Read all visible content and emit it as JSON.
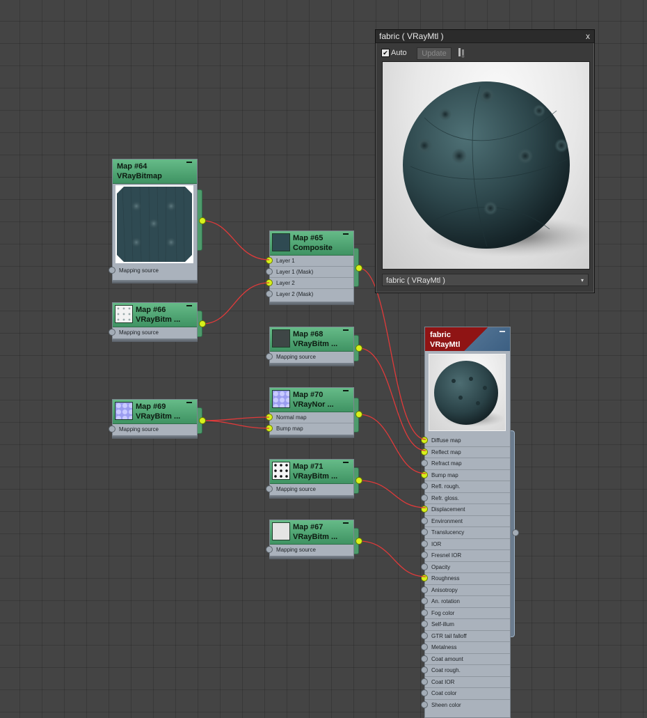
{
  "preview_window": {
    "title": "fabric  ( VRayMtl )",
    "close": "x",
    "auto_label": "Auto",
    "auto_checked": true,
    "update_label": "Update",
    "material_dropdown": "fabric  ( VRayMtl )",
    "dropdown_arrow": "▾"
  },
  "nodes": {
    "map64": {
      "name": "Map #64",
      "type": "VRayBitmap",
      "slots": [
        "Mapping source"
      ]
    },
    "map65": {
      "name": "Map #65",
      "type": "Composite",
      "slots": [
        "Layer 1",
        "Layer 1 (Mask)",
        "Layer 2",
        "Layer 2 (Mask)"
      ]
    },
    "map66": {
      "name": "Map #66",
      "type": "VRayBitm ...",
      "slots": [
        "Mapping source"
      ]
    },
    "map68": {
      "name": "Map #68",
      "type": "VRayBitm ...",
      "slots": [
        "Mapping source"
      ]
    },
    "map69": {
      "name": "Map #69",
      "type": "VRayBitm ...",
      "slots": [
        "Mapping source"
      ]
    },
    "map70": {
      "name": "Map #70",
      "type": "VRayNor ...",
      "slots": [
        "Normal map",
        "Bump map"
      ]
    },
    "map71": {
      "name": "Map #71",
      "type": "VRayBitm ...",
      "slots": [
        "Mapping source"
      ]
    },
    "map67": {
      "name": "Map #67",
      "type": "VRayBitm ...",
      "slots": [
        "Mapping source"
      ]
    }
  },
  "material": {
    "name": "fabric",
    "type": "VRayMtl",
    "slots": [
      "Diffuse map",
      "Reflect map",
      "Refract map",
      "Bump map",
      "Refl. rough.",
      "Refr. gloss.",
      "Displacement",
      "Environment",
      "Translucency",
      "IOR",
      "Fresnel IOR",
      "Opacity",
      "Roughness",
      "Anisotropy",
      "An. rotation",
      "Fog color",
      "Self-illum",
      "GTR tail falloff",
      "Metalness",
      "Coat amount",
      "Coat rough.",
      "Coat IOR",
      "Coat color",
      "Sheen color"
    ],
    "connected_slots": [
      "Diffuse map",
      "Reflect map",
      "Bump map",
      "Displacement",
      "Roughness"
    ]
  },
  "colors": {
    "canvas": "#444444",
    "node_header": "#4fa673",
    "socket_connected": "#d7f01c",
    "wire": "#e03a3a",
    "material_header": "#8f1414"
  }
}
